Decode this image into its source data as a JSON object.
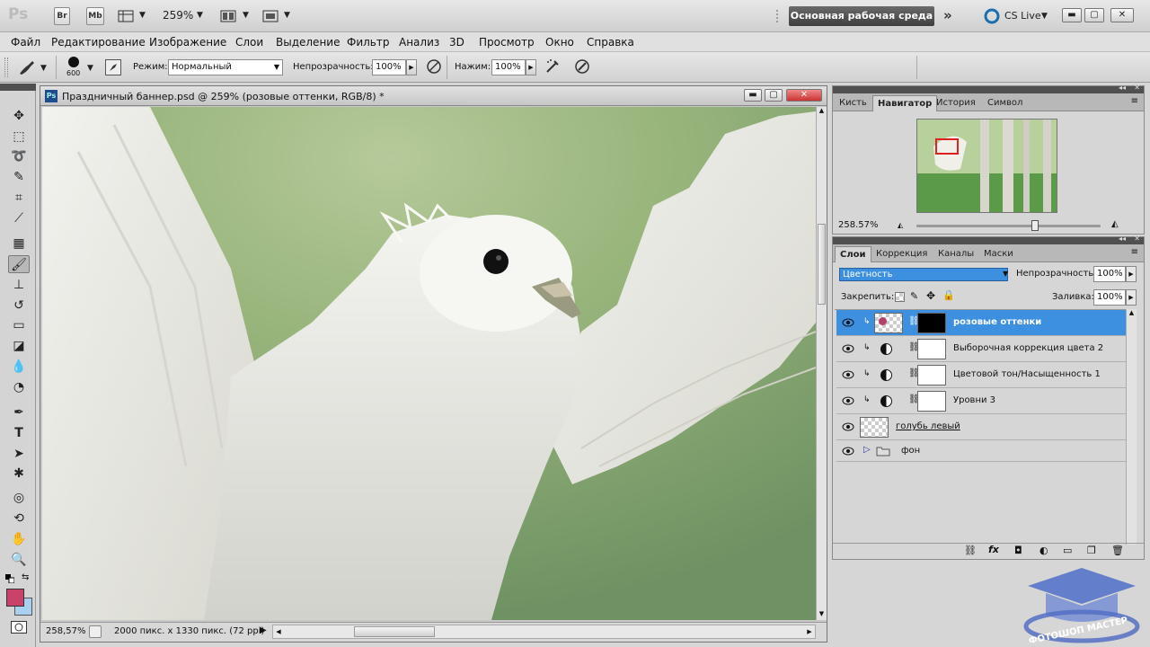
{
  "titlebar": {
    "logo": "Ps",
    "bridge_label": "Br",
    "minibridge_label": "Mb",
    "zoom": "259%",
    "workspace": "Основная рабочая среда",
    "cslive": "CS Live"
  },
  "menu": [
    "Файл",
    "Редактирование",
    "Изображение",
    "Слои",
    "Выделение",
    "Фильтр",
    "Анализ",
    "3D",
    "Просмотр",
    "Окно",
    "Справка"
  ],
  "options": {
    "brush_size": "600",
    "mode_label": "Режим:",
    "mode_value": "Нормальный",
    "opacity_label": "Непрозрачность:",
    "opacity_value": "100%",
    "pressure_label": "Нажим:",
    "pressure_value": "100%"
  },
  "document": {
    "title": "Праздничный баннер.psd @ 259% (розовые оттенки, RGB/8) *",
    "status_zoom": "258,57%",
    "status_info": "2000 пикс. x 1330 пикс. (72 ppi)"
  },
  "navigator_panel": {
    "tabs": [
      "Кисть",
      "Навигатор",
      "История",
      "Символ"
    ],
    "active_tab": "Навигатор",
    "zoom": "258.57%"
  },
  "layers_panel": {
    "tabs": [
      "Слои",
      "Коррекция",
      "Каналы",
      "Маски"
    ],
    "active_tab": "Слои",
    "blend_mode": "Цветность",
    "opacity_label": "Непрозрачность:",
    "opacity_value": "100%",
    "lock_label": "Закрепить:",
    "fill_label": "Заливка:",
    "fill_value": "100%",
    "layers": [
      {
        "name": "розовые оттенки",
        "selected": true
      },
      {
        "name": "Выборочная коррекция цвета 2",
        "selected": false
      },
      {
        "name": "Цветовой тон/Насыщенность 1",
        "selected": false
      },
      {
        "name": "Уровни 3",
        "selected": false
      },
      {
        "name": "голубь левый",
        "selected": false
      },
      {
        "name": "фон",
        "selected": false
      }
    ]
  },
  "colors": {
    "foreground": "#c8426a",
    "background": "#a9d0ee",
    "selection": "#3d8fe0"
  },
  "watermark": {
    "text": "ФОТОШОП МАСТЕР"
  }
}
